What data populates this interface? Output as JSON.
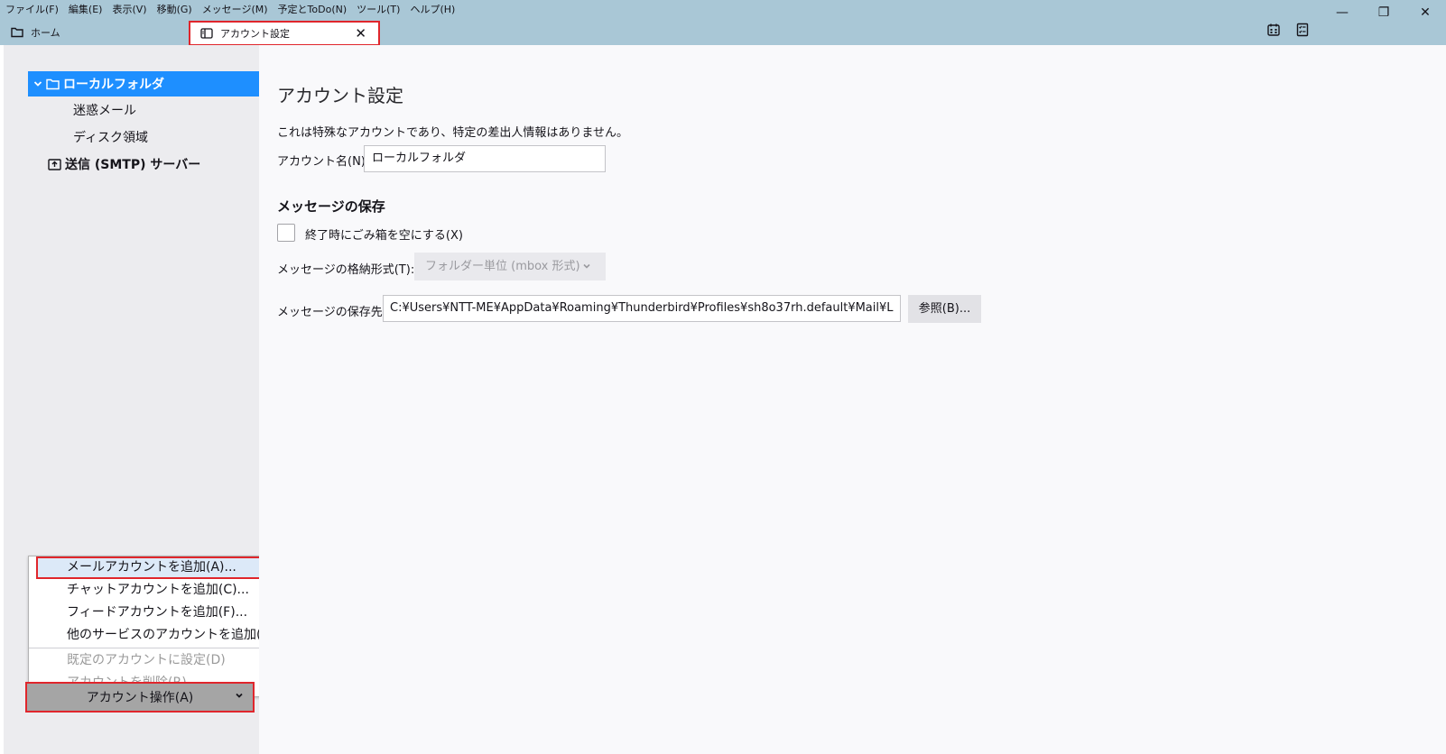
{
  "menu": {
    "items": [
      "ファイル(F)",
      "編集(E)",
      "表示(V)",
      "移動(G)",
      "メッセージ(M)",
      "予定とToDo(N)",
      "ツール(T)",
      "ヘルプ(H)"
    ]
  },
  "window": {
    "minimize": "—",
    "restore": "❐",
    "close": "✕"
  },
  "tabs": {
    "home": "ホーム",
    "active": "アカウント設定",
    "close": "✕"
  },
  "sidebar": {
    "local_folder": "ローカルフォルダ",
    "junk": "迷惑メール",
    "disk_space": "ディスク領域",
    "smtp": "送信 (SMTP) サーバー"
  },
  "popup": {
    "add_mail": "メールアカウントを追加(A)...",
    "add_chat": "チャットアカウントを追加(C)...",
    "add_feed": "フィードアカウントを追加(F)...",
    "add_other": "他のサービスのアカウントを追加(O)...",
    "set_default": "既定のアカウントに設定(D)",
    "remove": "アカウントを削除(R)"
  },
  "account_actions": "アカウント操作(A)",
  "main": {
    "heading": "アカウント設定",
    "description": "これは特殊なアカウントであり、特定の差出人情報はありません。",
    "account_name_label": "アカウント名(N):",
    "account_name_value": "ローカルフォルダ",
    "section_title": "メッセージの保存",
    "empty_trash_label": "終了時にごみ箱を空にする(X)",
    "store_type_label": "メッセージの格納形式(T):",
    "store_type_value": "フォルダー単位 (mbox 形式)",
    "local_dir_label": "メッセージの保存先:",
    "local_dir_value": "C:¥Users¥NTT-ME¥AppData¥Roaming¥Thunderbird¥Profiles¥sh8o37rh.default¥Mail¥L",
    "browse_button": "参照(B)..."
  },
  "colors": {
    "titlebar": "#a9c7d6",
    "selection": "#1e8fff",
    "highlight_border": "#e0262c"
  }
}
